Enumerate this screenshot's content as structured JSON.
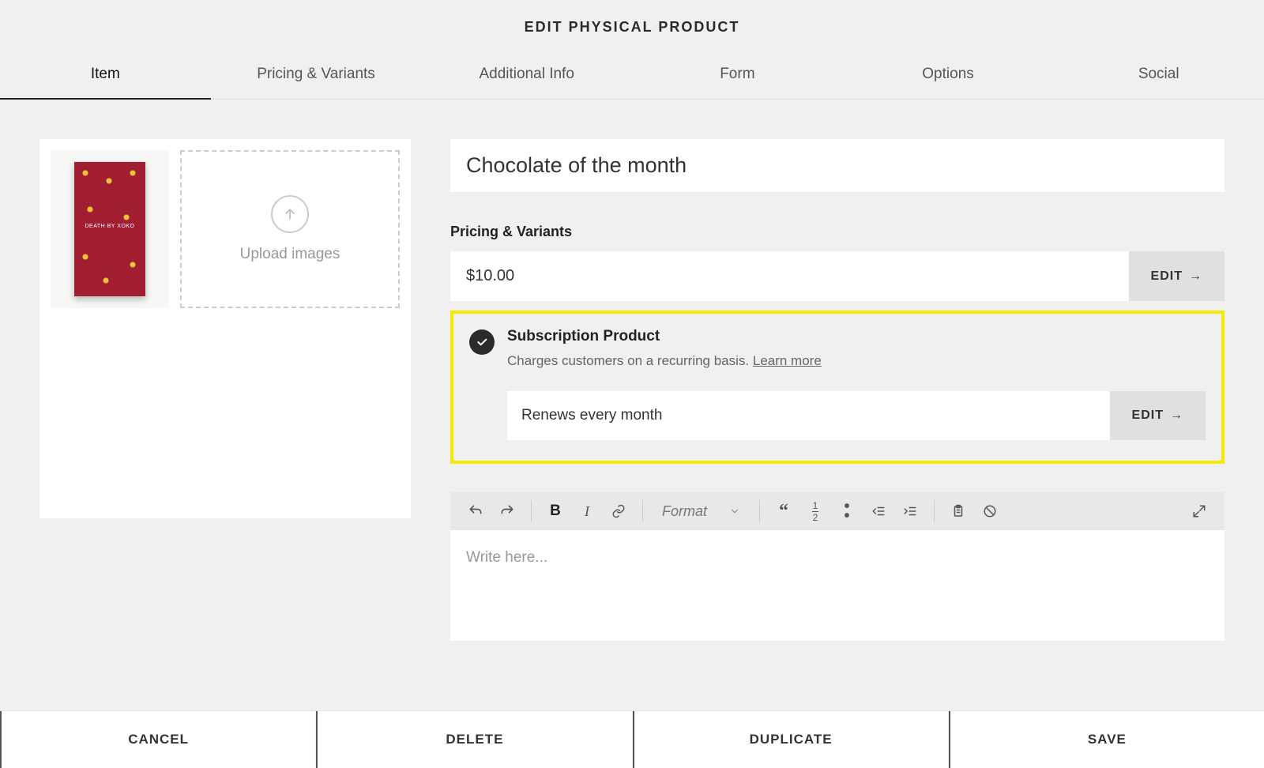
{
  "header": {
    "title": "EDIT PHYSICAL PRODUCT"
  },
  "tabs": [
    {
      "label": "Item",
      "active": true
    },
    {
      "label": "Pricing & Variants",
      "active": false
    },
    {
      "label": "Additional Info",
      "active": false
    },
    {
      "label": "Form",
      "active": false
    },
    {
      "label": "Options",
      "active": false
    },
    {
      "label": "Social",
      "active": false
    }
  ],
  "images": {
    "thumb_label": "DEATH BY XOKO",
    "upload_label": "Upload images"
  },
  "product": {
    "name": "Chocolate of the month"
  },
  "pricing": {
    "section_label": "Pricing & Variants",
    "price": "$10.00",
    "edit_label": "EDIT"
  },
  "subscription": {
    "title": "Subscription Product",
    "description": "Charges customers on a recurring basis. ",
    "learn_more": "Learn more",
    "renew_text": "Renews every month",
    "edit_label": "EDIT"
  },
  "editor": {
    "format_label": "Format",
    "placeholder": "Write here..."
  },
  "footer": {
    "cancel": "CANCEL",
    "delete": "DELETE",
    "duplicate": "DUPLICATE",
    "save": "SAVE"
  }
}
